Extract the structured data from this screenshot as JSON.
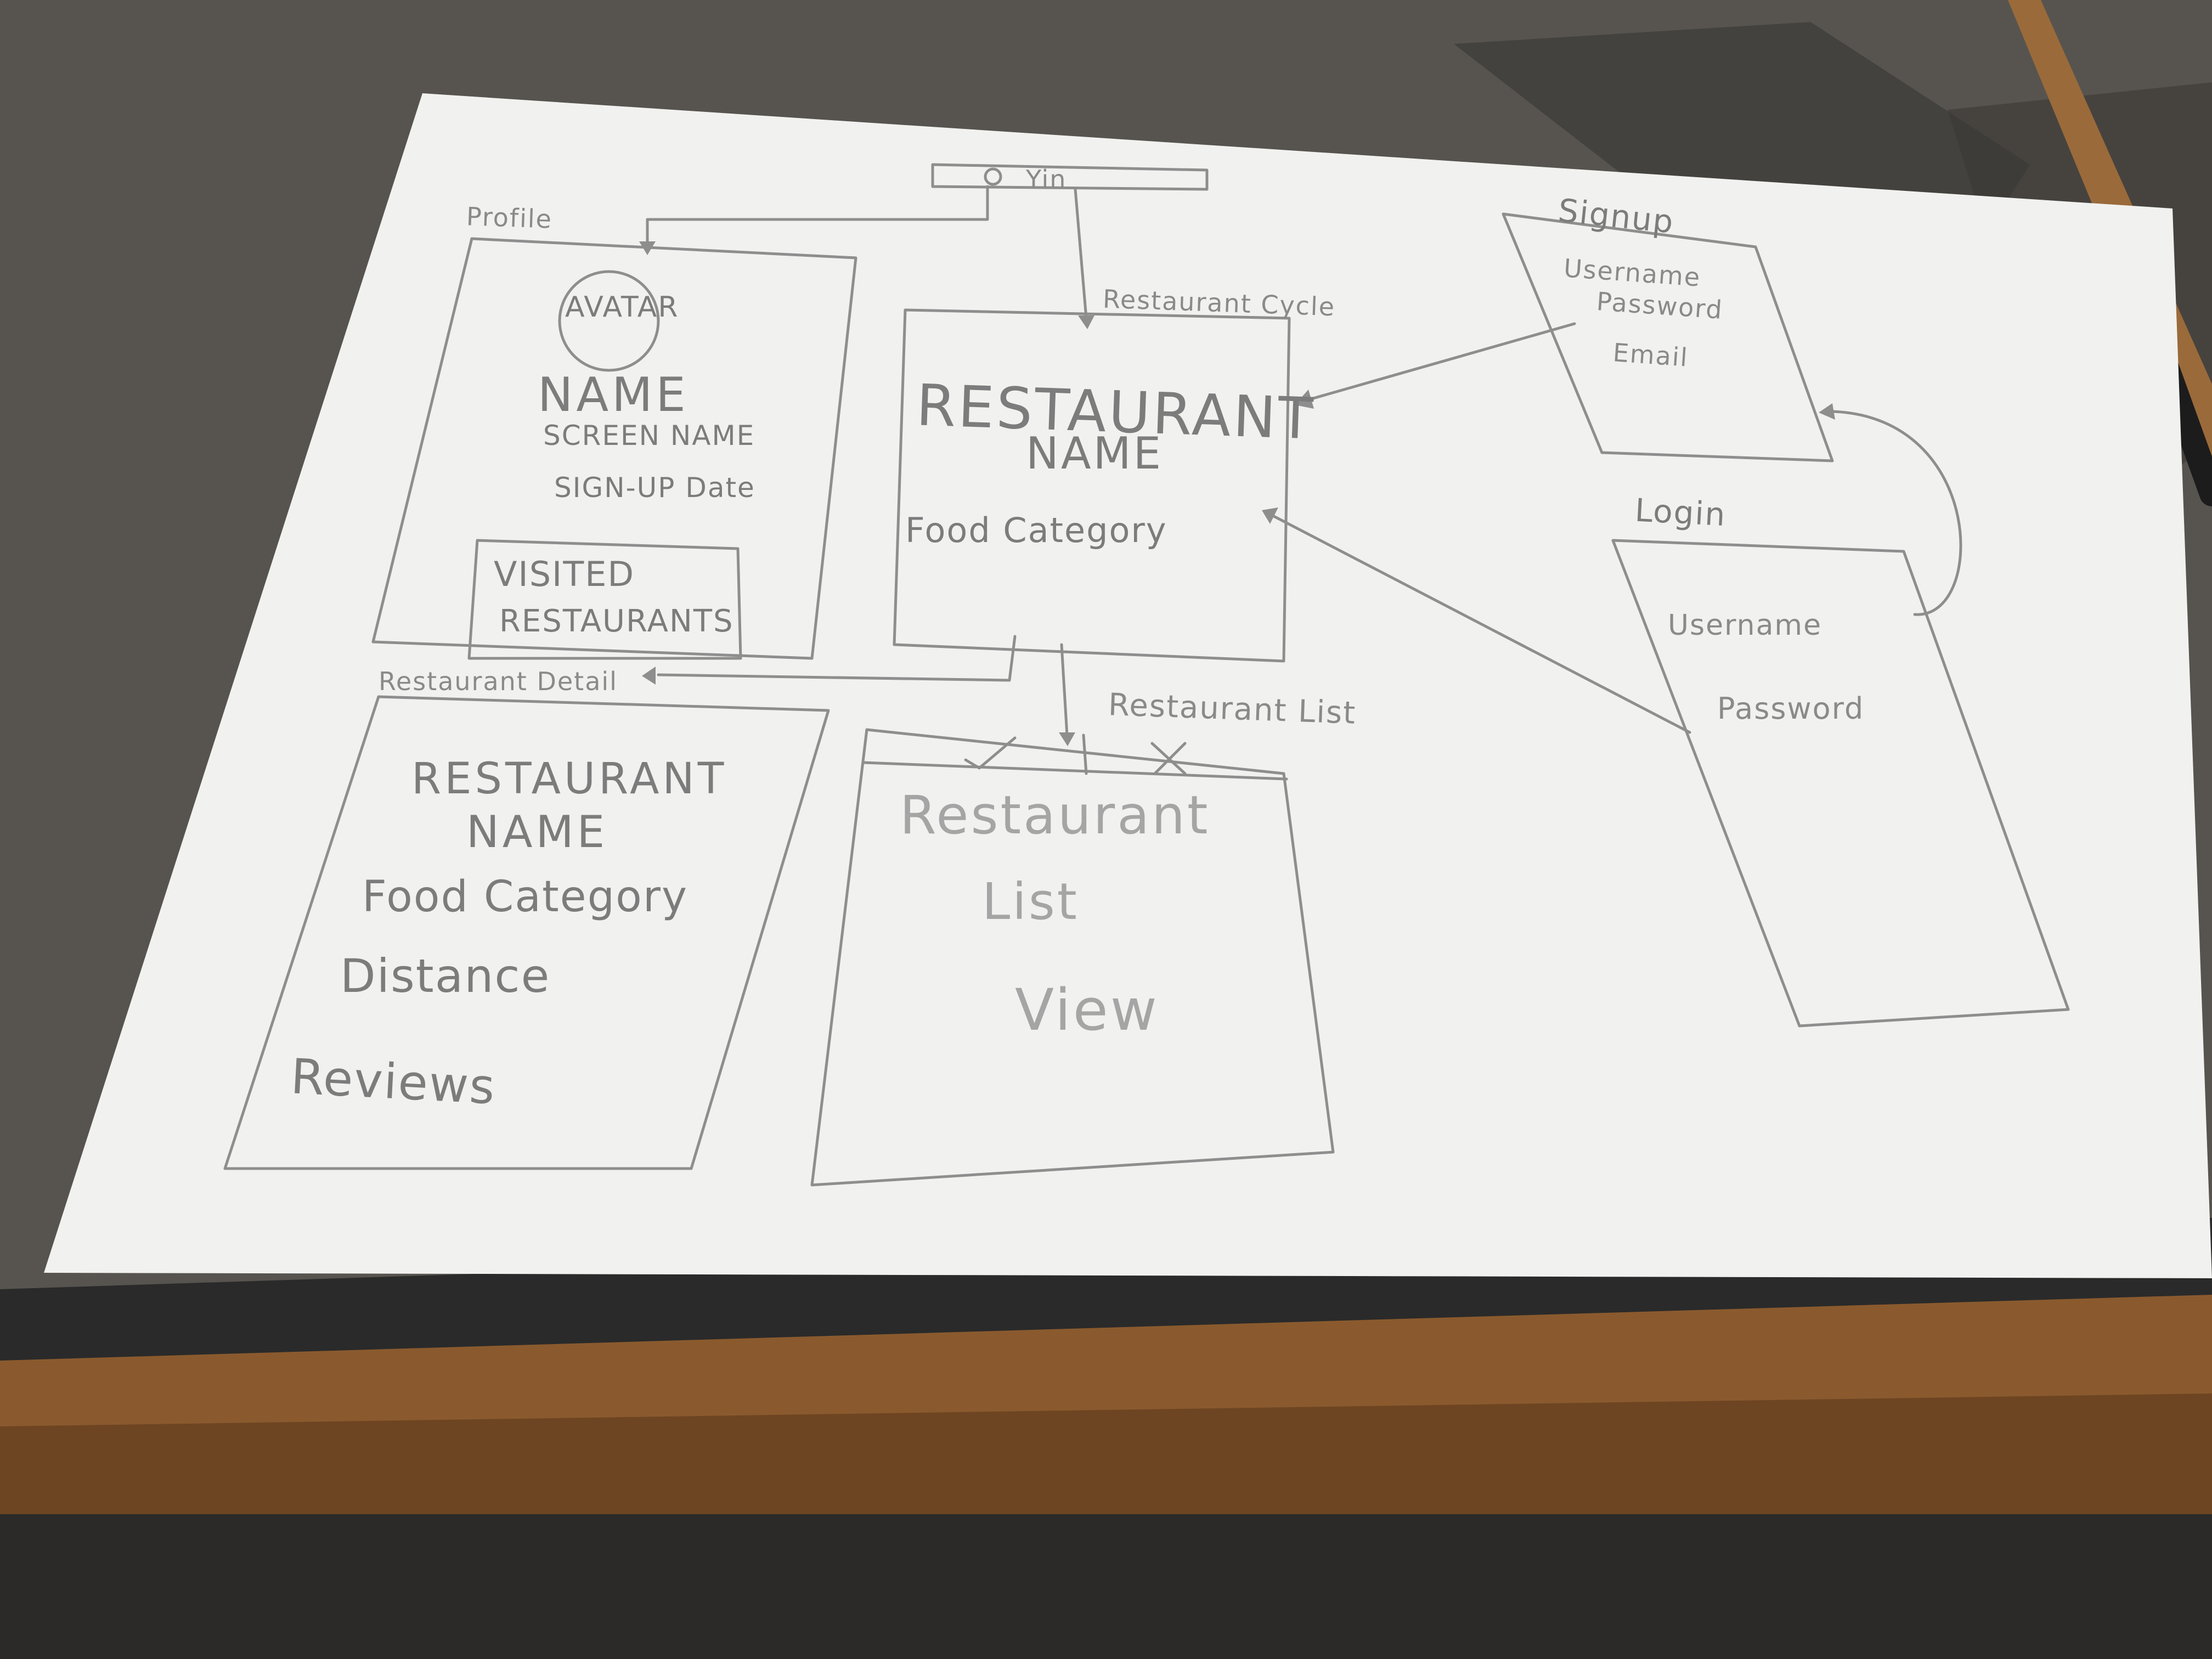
{
  "header": {
    "nav_label": "Yin"
  },
  "screens": {
    "profile": {
      "title": "Profile",
      "avatar": "AVATAR",
      "name": "NAME",
      "screen_name": "SCREEN NAME",
      "signup_date": "SIGN-UP Date",
      "visited_line1": "VISITED",
      "visited_line2": "RESTAURANTS"
    },
    "restaurant_cycle": {
      "title": "Restaurant Cycle",
      "name_line1": "RESTAURANT",
      "name_line2": "NAME",
      "food_category": "Food Category"
    },
    "signup": {
      "title": "Signup",
      "username": "Username",
      "password": "Password",
      "email": "Email"
    },
    "login": {
      "title": "Login",
      "username": "Username",
      "password": "Password"
    },
    "restaurant_detail": {
      "title": "Restaurant Detail",
      "name_line1": "RESTAURANT",
      "name_line2": "NAME",
      "food_category": "Food Category",
      "distance": "Distance",
      "reviews": "Reviews"
    },
    "restaurant_list": {
      "title": "Restaurant List",
      "check_icon": "check-icon",
      "x_icon": "x-icon",
      "body_line1": "Restaurant",
      "body_line2": "List",
      "body_line3": "View"
    }
  },
  "colors": {
    "pencil": "#8c8c8c",
    "paper": "#f2f2f0",
    "desk": "#55524d",
    "wood": "#8b5a2b"
  }
}
